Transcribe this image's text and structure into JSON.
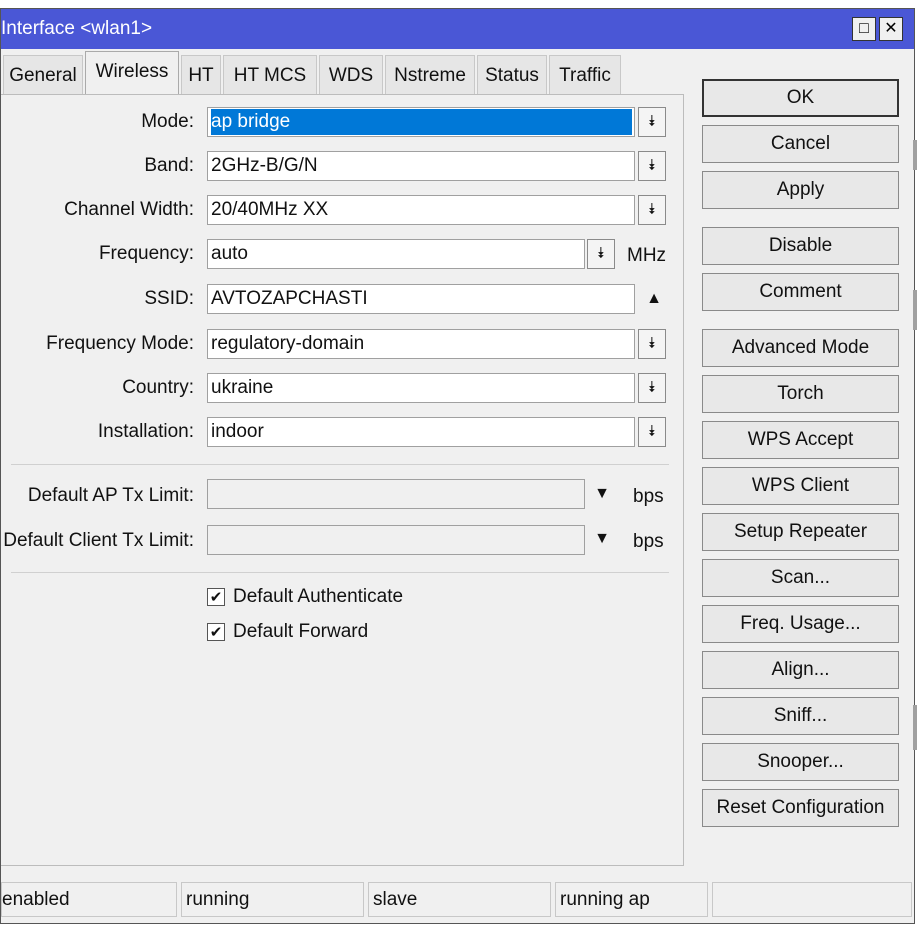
{
  "window": {
    "title": "Interface <wlan1>",
    "restore_glyph": "□",
    "close_glyph": "✕"
  },
  "tabs": [
    {
      "label": "General"
    },
    {
      "label": "Wireless",
      "active": true
    },
    {
      "label": "HT"
    },
    {
      "label": "HT MCS"
    },
    {
      "label": "WDS"
    },
    {
      "label": "Nstreme"
    },
    {
      "label": "Status"
    },
    {
      "label": "Traffic"
    }
  ],
  "form": {
    "mode": {
      "label": "Mode:",
      "value": "ap bridge"
    },
    "band": {
      "label": "Band:",
      "value": "2GHz-B/G/N"
    },
    "channel_width": {
      "label": "Channel Width:",
      "value": "20/40MHz XX"
    },
    "frequency": {
      "label": "Frequency:",
      "value": "auto",
      "unit": "MHz"
    },
    "ssid": {
      "label": "SSID:",
      "value": "AVTOZAPCHASTI"
    },
    "frequency_mode": {
      "label": "Frequency Mode:",
      "value": "regulatory-domain"
    },
    "country": {
      "label": "Country:",
      "value": "ukraine"
    },
    "installation": {
      "label": "Installation:",
      "value": "indoor"
    },
    "default_ap_tx_limit": {
      "label": "Default AP Tx Limit:",
      "value": "",
      "unit": "bps"
    },
    "default_client_tx_limit": {
      "label": "Default Client Tx Limit:",
      "value": "",
      "unit": "bps"
    },
    "default_authenticate": {
      "label": "Default Authenticate",
      "checked": true
    },
    "default_forward": {
      "label": "Default Forward",
      "checked": true
    }
  },
  "glyphs": {
    "dropdown": "⯯",
    "arrow_down": "▼",
    "arrow_up": "▲",
    "check": "✔"
  },
  "buttons": {
    "ok": "OK",
    "cancel": "Cancel",
    "apply": "Apply",
    "disable": "Disable",
    "comment": "Comment",
    "advanced_mode": "Advanced Mode",
    "torch": "Torch",
    "wps_accept": "WPS Accept",
    "wps_client": "WPS Client",
    "setup_repeater": "Setup Repeater",
    "scan": "Scan...",
    "freq_usage": "Freq. Usage...",
    "align": "Align...",
    "sniff": "Sniff...",
    "snooper": "Snooper...",
    "reset_configuration": "Reset Configuration"
  },
  "status_bar": [
    "enabled",
    "running",
    "slave",
    "running ap",
    ""
  ],
  "colors": {
    "titlebar": "#4a57d6",
    "selection": "#0078d7"
  }
}
